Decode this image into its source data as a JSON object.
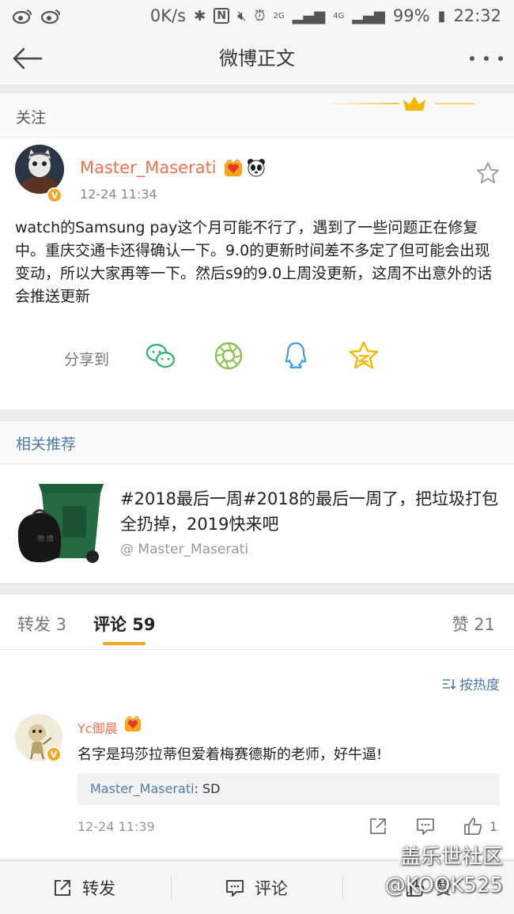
{
  "status_bar": {
    "speed": "0K/s",
    "signal_2g": "2G",
    "signal_4g": "4G",
    "battery": "99%",
    "time": "22:32"
  },
  "nav": {
    "title": "微博正文"
  },
  "follow_strip": {
    "label": "关注"
  },
  "post": {
    "author": "Master_Maserati",
    "time": "12-24 11:34",
    "verified_mark": "V",
    "text": "watch的Samsung pay这个月可能不行了，遇到了一些问题正在修复中。重庆交通卡还得确认一下。9.0的更新时间差不多定了但可能会出现变动，所以大家再等一下。然后s9的9.0上周没更新，这周不出意外的话会推送更新",
    "share_label": "分享到",
    "share_icons": [
      "wechat-icon",
      "moments-icon",
      "qq-icon",
      "qzone-icon"
    ]
  },
  "related": {
    "heading": "相关推荐",
    "title": "#2018最后一周#2018的最后一周了，把垃圾打包全扔掉，2019快来吧",
    "author": "@ Master_Maserati"
  },
  "tabs": {
    "repost": "转发 3",
    "comment": "评论 59",
    "like": "赞 21"
  },
  "comments": {
    "sort_label": "按热度",
    "items": [
      {
        "author": "Yc御晨",
        "text": "名字是玛莎拉蒂但爱着梅赛德斯的老师，好牛逼!",
        "reply_name": "Master_Maserati",
        "reply_text": ": SD",
        "time": "12-24 11:39",
        "likes": "1"
      }
    ]
  },
  "bottom_bar": {
    "repost": "转发",
    "comment": "评论",
    "like": "赞"
  },
  "watermark": {
    "line1": "盖乐世社区",
    "line2": "@KOOK525"
  },
  "colors": {
    "accent_orange": "#eb7350",
    "link_blue": "#4d7ba8",
    "tab_underline": "#f5a623"
  }
}
